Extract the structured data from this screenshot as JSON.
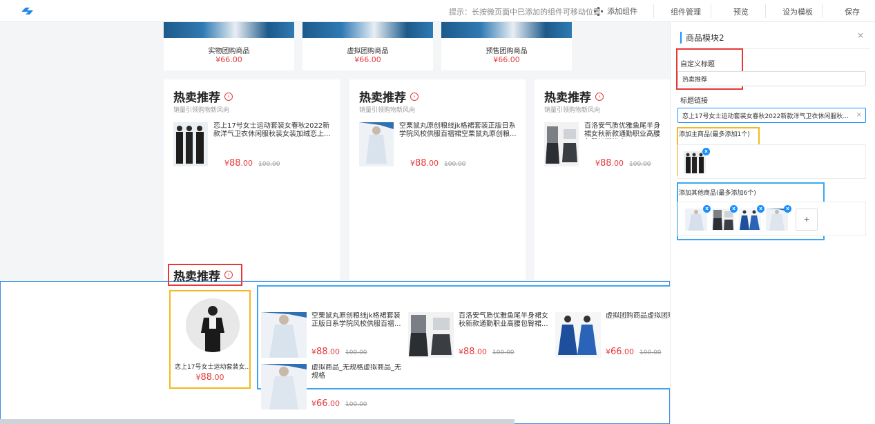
{
  "topbar": {
    "hint": "提示：长按微页面中已添加的组件可移动位置",
    "add_component": "添加组件",
    "nav": [
      "组件管理",
      "预览",
      "设为模板",
      "保存"
    ]
  },
  "group_buy": [
    {
      "name": "实物团购商品",
      "price_int": "66",
      "price_dec": ".00"
    },
    {
      "name": "虚拟团购商品",
      "price_int": "66",
      "price_dec": ".00"
    },
    {
      "name": "预售团购商品",
      "price_int": "66",
      "price_dec": ".00"
    }
  ],
  "hot_cards": [
    {
      "title": "热卖推荐",
      "subtitle": "销量引领购物新风向",
      "product_name": "恋上17号女士运动套装女春秋2022新款洋气卫衣休闲服秋装女装加绒恋上...",
      "price_int": "88",
      "price_dec": ".00",
      "old_price": "100.00"
    },
    {
      "title": "热卖推荐",
      "subtitle": "销量引领购物新风向",
      "product_name": "空栗鼠丸原创粮线jk格裙套装正版日系学院风校供服百褶裙空栗鼠丸原创粮...",
      "price_int": "88",
      "price_dec": ".00",
      "old_price": "100.00"
    },
    {
      "title": "热卖推荐",
      "subtitle": "销量引领购物新风向",
      "product_name": "百洛安气质优雅鱼尾半身裙女秋新款通勤职业高腰包臀裙百搭中",
      "price_int": "88",
      "price_dec": ".00",
      "old_price": "100.00"
    }
  ],
  "selected": {
    "title": "热卖推荐",
    "main": {
      "name": "恋上17号女士运动套装女...",
      "price_int": "88",
      "price_dec": ".00"
    },
    "others": [
      {
        "name": "空栗鼠丸原创粮线jk格裙套装正版日系学院风校供服百褶...",
        "price_int": "88",
        "price_dec": ".00",
        "old_price": "100.00"
      },
      {
        "name": "百洛安气质优雅鱼尾半身裙女秋新款通勤职业高腰包臀裙...",
        "price_int": "88",
        "price_dec": ".00",
        "old_price": "100.00"
      },
      {
        "name": "虚拟团购商品虚拟团购",
        "price_int": "66",
        "price_dec": ".00",
        "old_price": "100.00"
      },
      {
        "name": "虚拟商品_无规格虚拟商品_无规格",
        "price_int": "66",
        "price_dec": ".00",
        "old_price": "100.00"
      }
    ]
  },
  "panel": {
    "title": "商品模块2",
    "custom_title_label": "自定义标题",
    "custom_title_value": "热卖推荐",
    "title_link_label": "标题链接",
    "title_link_value": "恋上17号女士运动套装女春秋2022新款洋气卫衣休闲服秋...",
    "main_label": "添加主商品(最多添加1个)",
    "others_label": "添加其他商品(最多添加6个)",
    "plus": "+",
    "close": "×",
    "x": "x"
  },
  "currency": "¥"
}
